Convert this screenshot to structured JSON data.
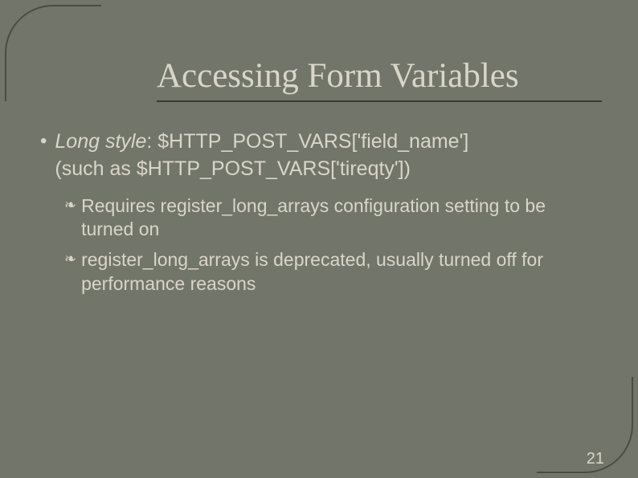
{
  "title": "Accessing Form Variables",
  "bullet": {
    "lead": "Long style",
    "code1": "$HTTP_POST_VARS['field_name']",
    "line2a": "(such as ",
    "code2": "$HTTP_POST_VARS['tireqty']",
    "line2b": ")"
  },
  "sub": [
    "Requires register_long_arrays configuration setting to be turned on",
    "register_long_arrays is deprecated, usually turned off  for performance reasons"
  ],
  "page": "21"
}
